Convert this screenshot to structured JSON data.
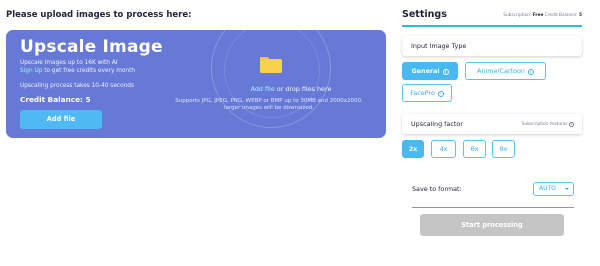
{
  "page": {
    "heading": "Please upload images to process here:"
  },
  "upload": {
    "title": "Upscale Image",
    "line1": "Upscale Images up to 16K with AI",
    "signup_link": "Sign Up",
    "line2_rest": " to get free credits every month",
    "line3": "Upscaling process takes 10-40 seconds",
    "credit_balance": "Credit Balance: 5",
    "add_file_button": "Add file",
    "drop_link": "Add file",
    "drop_rest": " or drop files here",
    "support_line1": "Supports JPG, JPEG, PNG, WEBP or BMP up to 30MB and 2000x2000,",
    "support_line2": "larger images will be downsized.",
    "folder_icon": "folder-icon",
    "card_color": "#6779d6",
    "button_color": "#4fb9f3"
  },
  "settings": {
    "title": "Settings",
    "subscription_label": "Subscription:",
    "subscription_value": "Free",
    "credit_balance_label": "Credit Balance:",
    "credit_balance_value": "5",
    "accent_color": "#4ab8f1",
    "input_type": {
      "label": "Input Image Type",
      "options": [
        {
          "label": "General",
          "active": true,
          "icon": "info-icon"
        },
        {
          "label": "Anime/Cartoon",
          "active": false,
          "icon": "info-icon"
        },
        {
          "label": "FacePro",
          "active": false,
          "icon": "info-icon"
        }
      ]
    },
    "upscaling": {
      "label": "Upscaling factor",
      "hint": "Subscription features",
      "options": [
        {
          "label": "2x",
          "active": true
        },
        {
          "label": "4x",
          "active": false
        },
        {
          "label": "6x",
          "active": false
        },
        {
          "label": "8x",
          "active": false
        }
      ]
    },
    "format": {
      "label": "Save to format:",
      "selected": "AUTO"
    },
    "start_button": "Start processing"
  }
}
